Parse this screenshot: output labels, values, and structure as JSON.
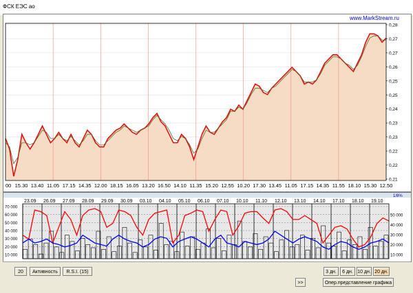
{
  "window": {
    "title": "ФСК ЕЭС ао",
    "source": "www.MarkStream.ru"
  },
  "colors": {
    "price_line": "#e0120e",
    "ma_line": "#556b2f",
    "area_fill": "#f6dcc4",
    "activity_red": "#ff0000",
    "activity_blue": "#0000ff",
    "bars": "#000000",
    "grid": "#dcdcdc",
    "period_marker": "#ef8e7f",
    "sub_bg": "#e8e8e8",
    "active_button": "#f4d8b0"
  },
  "chart_data": [
    {
      "type": "line",
      "title": "",
      "x_tick_labels": [
        "00",
        "15.30",
        "13.40",
        "11.05",
        "17.15",
        "14.35",
        "12.00",
        "18.15",
        "16.05",
        "13.20",
        "16.50",
        "14.10",
        "11.35",
        "15.20",
        "12.55",
        "10.20",
        "17.30",
        "13.45",
        "11.05",
        "17.15",
        "14.35",
        "11.55",
        "18.10",
        "15.30",
        "12.50"
      ],
      "y_tick_labels": [
        "0,28",
        "0,27",
        "0,27",
        "0,26",
        "0,25",
        "0,25",
        "0,24",
        "0,23",
        "0,23",
        "0,22",
        "0,22",
        "0,21"
      ],
      "ylim": [
        0.21,
        0.285
      ],
      "series": [
        {
          "role": "price",
          "values": [
            0.23,
            0.225,
            0.212,
            0.22,
            0.232,
            0.228,
            0.225,
            0.228,
            0.232,
            0.236,
            0.232,
            0.228,
            0.23,
            0.233,
            0.23,
            0.228,
            0.232,
            0.228,
            0.226,
            0.23,
            0.234,
            0.232,
            0.228,
            0.226,
            0.226,
            0.23,
            0.232,
            0.234,
            0.235,
            0.237,
            0.235,
            0.233,
            0.232,
            0.234,
            0.235,
            0.237,
            0.24,
            0.242,
            0.238,
            0.236,
            0.232,
            0.228,
            0.228,
            0.232,
            0.23,
            0.226,
            0.22,
            0.226,
            0.232,
            0.236,
            0.233,
            0.232,
            0.235,
            0.238,
            0.24,
            0.244,
            0.243,
            0.246,
            0.244,
            0.248,
            0.252,
            0.256,
            0.255,
            0.252,
            0.251,
            0.254,
            0.256,
            0.258,
            0.26,
            0.262,
            0.264,
            0.262,
            0.26,
            0.256,
            0.257,
            0.256,
            0.258,
            0.262,
            0.266,
            0.268,
            0.27,
            0.27,
            0.268,
            0.266,
            0.264,
            0.262,
            0.266,
            0.27,
            0.276,
            0.28,
            0.28,
            0.279,
            0.276,
            0.278
          ]
        },
        {
          "role": "moving-average",
          "values": [
            0.228,
            0.226,
            0.218,
            0.221,
            0.228,
            0.228,
            0.227,
            0.228,
            0.231,
            0.234,
            0.233,
            0.23,
            0.23,
            0.232,
            0.23,
            0.229,
            0.231,
            0.229,
            0.227,
            0.229,
            0.232,
            0.232,
            0.229,
            0.227,
            0.227,
            0.229,
            0.231,
            0.233,
            0.234,
            0.236,
            0.235,
            0.234,
            0.233,
            0.234,
            0.235,
            0.236,
            0.239,
            0.241,
            0.239,
            0.237,
            0.234,
            0.23,
            0.229,
            0.231,
            0.23,
            0.227,
            0.223,
            0.225,
            0.23,
            0.234,
            0.233,
            0.233,
            0.235,
            0.237,
            0.239,
            0.243,
            0.243,
            0.245,
            0.244,
            0.247,
            0.251,
            0.254,
            0.254,
            0.253,
            0.252,
            0.254,
            0.255,
            0.257,
            0.259,
            0.261,
            0.263,
            0.262,
            0.26,
            0.257,
            0.257,
            0.257,
            0.258,
            0.261,
            0.265,
            0.267,
            0.269,
            0.269,
            0.268,
            0.266,
            0.265,
            0.263,
            0.265,
            0.269,
            0.274,
            0.278,
            0.279,
            0.279,
            0.277,
            0.277
          ]
        }
      ]
    },
    {
      "type": "bar",
      "title": "",
      "scale_label": "1/8%",
      "x_tick_labels": [
        "23.09",
        "26.09",
        "27.09",
        "28.09",
        "29.09",
        "30.09",
        "03.10",
        "04.10",
        "05.10",
        "06.10",
        "07.10",
        "10.10",
        "11.10",
        "12.10",
        "13.10",
        "14.10",
        "17.10",
        "18.10",
        "19.10"
      ],
      "y_tick_labels_left": [
        "70 000",
        "60 000",
        "50 000",
        "40 000",
        "30 000",
        "20 000",
        "10 000"
      ],
      "y_tick_labels_right": [
        "50 000",
        "40 000",
        "30 000",
        "20 000",
        "10 000"
      ],
      "ylim": [
        0,
        70000
      ],
      "series": [
        {
          "role": "red-line",
          "values": [
            30000,
            25000,
            62000,
            60000,
            55000,
            20000,
            40000,
            60000,
            50000,
            30000,
            55000,
            62000,
            64000,
            60000,
            40000,
            45000,
            62000,
            60000,
            55000,
            40000,
            30000,
            50000,
            58000,
            60000,
            62000,
            20000,
            30000,
            55000,
            58000,
            62000,
            60000,
            35000,
            50000,
            62000,
            60000,
            30000,
            42000,
            58000,
            60000,
            60000,
            52000,
            45000,
            62000,
            64000,
            60000,
            50000,
            50000,
            55000,
            50000,
            45000,
            20000,
            30000,
            40000,
            42000,
            38000,
            25000,
            15000,
            18000,
            28000,
            45000,
            52000,
            48000
          ]
        },
        {
          "role": "blue-line",
          "values": [
            20000,
            25000,
            20000,
            22000,
            25000,
            20000,
            18000,
            15000,
            17000,
            20000,
            30000,
            25000,
            20000,
            18000,
            16000,
            25000,
            30000,
            25000,
            22000,
            20000,
            15000,
            18000,
            25000,
            28000,
            26000,
            15000,
            22000,
            25000,
            28000,
            25000,
            20000,
            15000,
            25000,
            30000,
            20000,
            18000,
            15000,
            22000,
            20000,
            18000,
            20000,
            25000,
            35000,
            30000,
            25000,
            20000,
            25000,
            28000,
            25000,
            22000,
            15000,
            12000,
            18000,
            22000,
            20000,
            15000,
            12000,
            15000,
            20000,
            22000,
            25000,
            20000
          ]
        },
        {
          "role": "volume-bars",
          "values": [
            12000,
            25000,
            18000,
            6000,
            20000,
            35000,
            15000,
            8000,
            30000,
            22000,
            10000,
            26000,
            18000,
            14000,
            35000,
            12000,
            28000,
            9000,
            16000,
            40000,
            20000,
            8000,
            24000,
            15000,
            30000,
            11000,
            45000,
            18000,
            22000,
            9000,
            34000,
            16000,
            28000,
            12000,
            20000,
            38000,
            14000,
            26000,
            10000,
            30000,
            18000,
            48000,
            22000,
            15000,
            32000,
            12000,
            28000,
            20000,
            9000,
            24000,
            36000,
            15000,
            18000,
            30000,
            11000,
            26000,
            14000,
            42000,
            20000,
            16000,
            34000,
            10000,
            24000,
            18000,
            28000,
            12000,
            40000,
            16000,
            22000,
            30000
          ]
        }
      ]
    }
  ],
  "controls": {
    "period_value": "20",
    "activity_button": "Активность",
    "rsi_button": "R.S.I. (15)",
    "range_3d": "3 дн.",
    "range_6d": "6 дн.",
    "range_10d": "10 дн.",
    "range_20d": "20 дн.",
    "forward_button": ">>",
    "operational_button": "Опер.представление графика"
  }
}
